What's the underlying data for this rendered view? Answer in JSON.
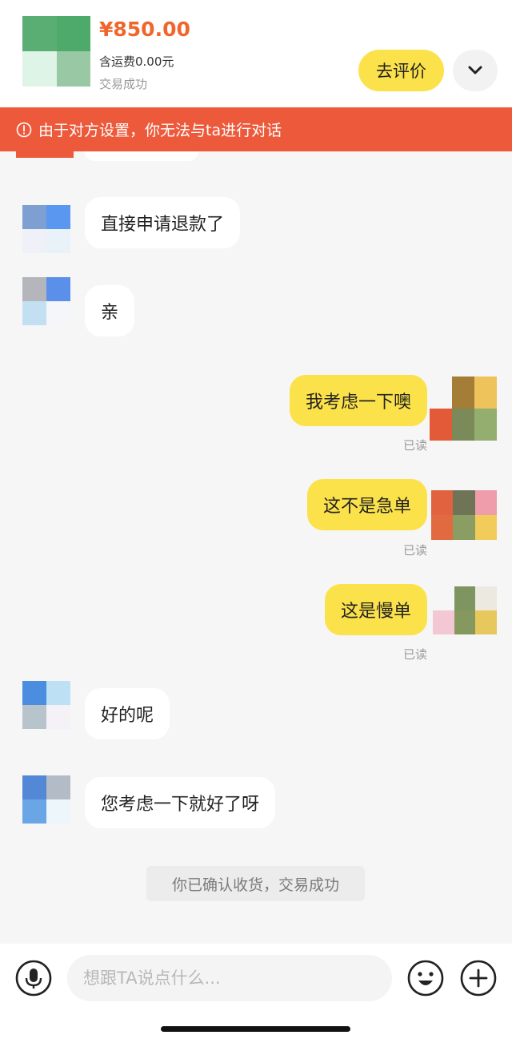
{
  "order": {
    "price": "¥850.00",
    "shipping": "含运费0.00元",
    "status": "交易成功",
    "review_label": "去评价",
    "expand_icon": "chevron-down-icon",
    "thumb_colors": [
      "#5bae73",
      "#4daa6a",
      "#def4e7",
      "#98c9a4"
    ]
  },
  "banner": {
    "icon": "alert-circle-icon",
    "text": "由于对方设置，你无法与ta进行对话",
    "color": "#ed5a3b"
  },
  "messages": [
    {
      "side": "left",
      "text": "直接申请退款了",
      "avatar_colors": [
        "#7d9fd2",
        "#5a97f0",
        "#f0f0f8",
        "#e9f2f8"
      ]
    },
    {
      "side": "left",
      "text": "亲",
      "avatar_colors": [
        "#b4b6bc",
        "#5a90ea",
        "#c3e0f2",
        "#f4f6fa"
      ]
    },
    {
      "side": "right",
      "text": "我考虑一下噢",
      "status": "已读",
      "avatar_colors": [
        "#a47e37",
        "#efc35b",
        "#7a8a58",
        "#93ae6f"
      ]
    },
    {
      "side": "right",
      "text": "这不是急单",
      "status": "已读",
      "avatar_colors": [
        "#e0623f",
        "#707457",
        "#ef9cab",
        "#e16a40",
        "#8a9e63",
        "#f1cc5a"
      ]
    },
    {
      "side": "right",
      "text": "这是慢单",
      "status": "已读",
      "avatar_colors": [
        "#7e9561",
        "#eceae0",
        "#f3c7d4",
        "#85995f",
        "#e7c85c"
      ]
    },
    {
      "side": "left",
      "text": "好的呢",
      "avatar_colors": [
        "#4b8ee0",
        "#bde0f4",
        "#b8c4cc",
        "#f4f2f6"
      ]
    },
    {
      "side": "left",
      "text": "您考虑一下就好了呀",
      "avatar_colors": [
        "#5288d6",
        "#b3bcc6",
        "#6aa6e6",
        "#edf7fb"
      ]
    }
  ],
  "system_notice": "你已确认收货，交易成功",
  "input": {
    "placeholder": "想跟TA说点什么...",
    "value": "",
    "voice_icon": "microphone-icon",
    "emoji_icon": "emoji-icon",
    "plus_icon": "plus-icon"
  },
  "colors": {
    "accent_yellow": "#fce24a",
    "price_orange": "#f0652b",
    "background": "#f6f6f6"
  }
}
